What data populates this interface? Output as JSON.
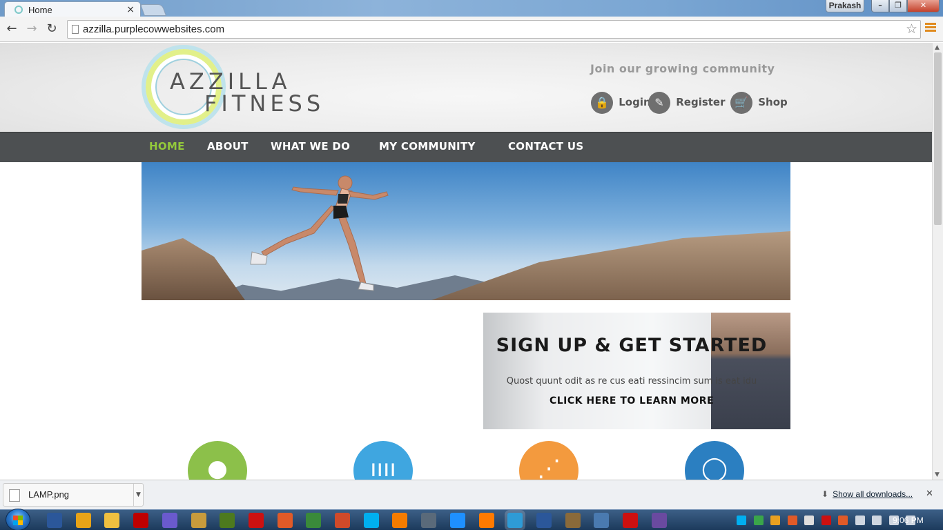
{
  "browser": {
    "tab_title": "Home",
    "tab_close": "×",
    "profile_name": "Prakash",
    "window_buttons": {
      "minimize": "–",
      "maximize": "❐",
      "close": "✕"
    },
    "nav": {
      "back": "←",
      "forward": "→",
      "reload": "↻"
    },
    "url": "azzilla.purplecowwebsites.com",
    "bookmark_star": "☆"
  },
  "site": {
    "logo_line1": "AZZILLA",
    "logo_line2": "FITNESS",
    "tagline": "Join our growing community",
    "header_links": [
      {
        "label": "Login",
        "icon": "lock-icon",
        "glyph": "🔒"
      },
      {
        "label": "Register",
        "icon": "pencil-icon",
        "glyph": "✎"
      },
      {
        "label": "Shop",
        "icon": "cart-icon",
        "glyph": "🛒"
      }
    ],
    "nav": [
      {
        "label": "HOME",
        "active": true
      },
      {
        "label": "ABOUT"
      },
      {
        "label": "WHAT WE DO"
      },
      {
        "label": "MY COMMUNITY"
      },
      {
        "label": "CONTACT US"
      }
    ],
    "signup": {
      "title": "SIGN UP & GET STARTED",
      "description": "Quost quunt odit as re cus eati ressincim sum is eat idu",
      "cta": "CLICK HERE TO LEARN MORE"
    },
    "features": [
      {
        "icon": "apple-icon",
        "color": "#8cc04a"
      },
      {
        "icon": "dumbbell-icon",
        "color": "#3fa6e0"
      },
      {
        "icon": "share-icon",
        "color": "#f39a3e"
      },
      {
        "icon": "chat-icon",
        "color": "#2b7fc1"
      }
    ],
    "colors": {
      "nav_bg": "#4d5052",
      "nav_active": "#93c93b"
    }
  },
  "downloads": {
    "file_name": "LAMP.png",
    "show_all": "Show all downloads...",
    "close": "✕"
  },
  "taskbar": {
    "clock": "9:06 PM",
    "pinned_icons": [
      "word-icon",
      "media-player-icon",
      "file-explorer-icon",
      "filezilla-icon",
      "visual-studio-icon",
      "tools-icon",
      "dreamweaver-icon",
      "opera-icon",
      "git-icon",
      "network-icon",
      "share-icon",
      "skype-icon",
      "xampp-icon",
      "network-settings-icon",
      "internet-explorer-icon",
      "firefox-icon",
      "chrome-icon",
      "word-doc-icon",
      "presentation-icon",
      "virtualbox-icon",
      "acrobat-icon",
      "app-icon"
    ],
    "tray_icons": [
      "skype-tray-icon",
      "settings-tray-icon",
      "shield-tray-icon",
      "xampp-tray-icon",
      "flag-tray-icon",
      "acrobat-tray-icon",
      "xampp-tray-icon",
      "messenger-tray-icon",
      "signal-icon",
      "battery-icon",
      "volume-icon"
    ]
  }
}
